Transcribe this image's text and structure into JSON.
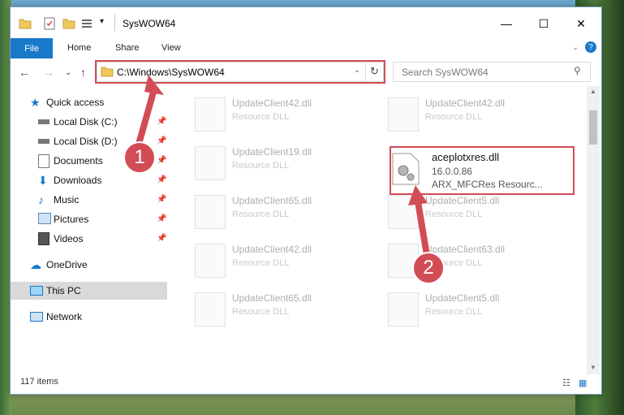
{
  "window": {
    "title": "SysWOW64",
    "controls": [
      "minimize",
      "maximize",
      "close"
    ]
  },
  "ribbon": {
    "tabs": [
      "File",
      "Home",
      "Share",
      "View"
    ],
    "help_glyph": "?"
  },
  "nav": {
    "address": "C:\\Windows\\SysWOW64",
    "search_placeholder": "Search SysWOW64"
  },
  "sidebar": {
    "items": [
      {
        "label": "Quick access",
        "icon": "star-icon"
      },
      {
        "label": "Local Disk (C:)",
        "icon": "drive-icon",
        "pinned": true
      },
      {
        "label": "Local Disk (D:)",
        "icon": "drive-icon",
        "pinned": true
      },
      {
        "label": "Documents",
        "icon": "documents-icon",
        "pinned": true
      },
      {
        "label": "Downloads",
        "icon": "downloads-icon",
        "pinned": true
      },
      {
        "label": "Music",
        "icon": "music-icon",
        "pinned": true
      },
      {
        "label": "Pictures",
        "icon": "pictures-icon",
        "pinned": true
      },
      {
        "label": "Videos",
        "icon": "videos-icon",
        "pinned": true
      },
      {
        "label": "OneDrive",
        "icon": "cloud-icon"
      },
      {
        "label": "This PC",
        "icon": "computer-icon",
        "selected": true
      },
      {
        "label": "Network",
        "icon": "network-icon"
      }
    ]
  },
  "files": [
    {
      "name": "UpdateClient42.dll",
      "type": "Resource DLL"
    },
    {
      "name": "UpdateClient42.dll",
      "type": "Resource DLL"
    },
    {
      "name": "UpdateClient19.dll",
      "type": "Resource DLL"
    },
    {
      "name": "aceplotxres.dll",
      "version": "16.0.0.86",
      "type": "ARX_MFCRes  Resourc...",
      "highlighted": true
    },
    {
      "name": "UpdateClient65.dll",
      "type": "Resource DLL"
    },
    {
      "name": "UpdateClient5.dll",
      "type": "Resource DLL"
    },
    {
      "name": "UpdateClient42.dll",
      "type": "Resource DLL"
    },
    {
      "name": "UpdateClient63.dll",
      "type": "Resource DLL"
    },
    {
      "name": "UpdateClient65.dll",
      "type": "Resource DLL"
    },
    {
      "name": "UpdateClient5.dll",
      "type": "Resource DLL"
    }
  ],
  "status": {
    "items_count": "117 items"
  },
  "annotations": {
    "step1": "1",
    "step2": "2",
    "color": "#d24c56"
  }
}
